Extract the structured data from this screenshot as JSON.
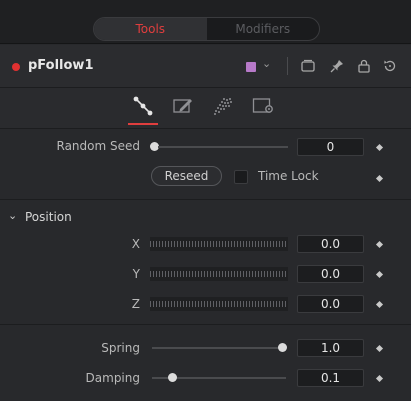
{
  "tabs": [
    {
      "label": "Tools",
      "active": true
    },
    {
      "label": "Modifiers",
      "active": false
    }
  ],
  "tool": {
    "name": "pFollow1",
    "color": "#b77ac9"
  },
  "header_icons": [
    "window-icon",
    "pin-icon",
    "lock-icon",
    "reset-icon"
  ],
  "inspector_tabs": [
    "controls-tab-icon",
    "style-tab-icon",
    "particles-tab-icon",
    "settings-tab-icon"
  ],
  "random_seed": {
    "label": "Random Seed",
    "value": "0"
  },
  "reseed": {
    "label": "Reseed"
  },
  "time_lock": {
    "label": "Time Lock",
    "checked": false
  },
  "position": {
    "title": "Position",
    "x": {
      "label": "X",
      "value": "0.0"
    },
    "y": {
      "label": "Y",
      "value": "0.0"
    },
    "z": {
      "label": "Z",
      "value": "0.0"
    }
  },
  "spring": {
    "label": "Spring",
    "value": "1.0",
    "level": 1.0
  },
  "damping": {
    "label": "Damping",
    "value": "0.1",
    "level": 0.1
  }
}
